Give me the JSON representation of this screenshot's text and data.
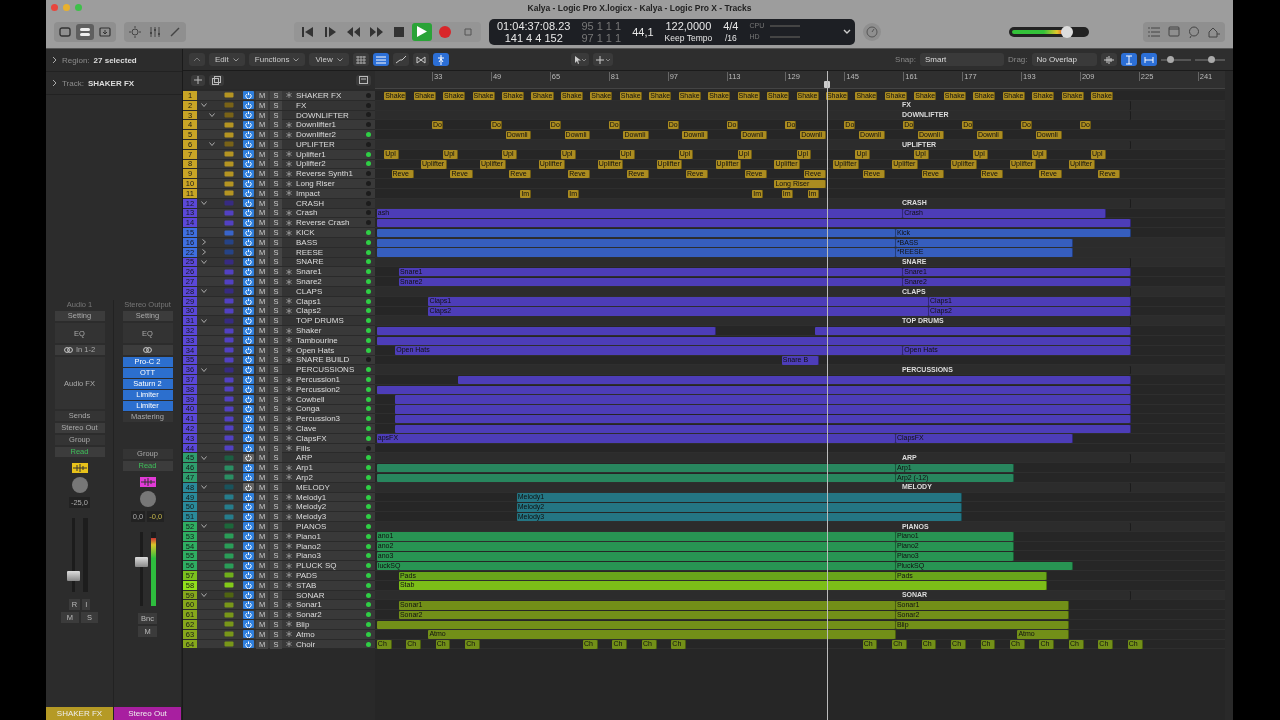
{
  "window": {
    "title": "Kalya - Logic Pro X.logicx - Kalya - Logic Pro X - Tracks"
  },
  "lcd": {
    "time": "01:04:37:08.23",
    "bars": "141 4 4 152",
    "locator_start": "95 1 1 1",
    "locator_end": "97 1 1 1",
    "sample_rate": "44,1",
    "tempo": "122,0000",
    "tempo_mode": "Keep Tempo",
    "signature": "4/4",
    "division": "/16",
    "cpu_label": "CPU",
    "hd_label": "HD"
  },
  "transport": {
    "playing": true,
    "recording": false
  },
  "master_volume": {
    "level": 0.72
  },
  "inspector": {
    "region_label": "Region:",
    "region_value": "27 selected",
    "track_label": "Track:",
    "track_value": "SHAKER FX"
  },
  "strips": [
    {
      "header": "Audio 1",
      "setting": "Setting",
      "eq": "EQ",
      "input": "In 1-2",
      "fx_label": "Audio FX",
      "sends": "Sends",
      "output": "Stereo Out",
      "group": "Group",
      "automation": "Read",
      "icon": {
        "color": "#e8c21a"
      },
      "pan": "-25,0",
      "fader": {
        "level": 0.22
      },
      "rec": [
        "R",
        "I"
      ],
      "buttons": [
        "M",
        "S"
      ],
      "name": "SHAKER FX",
      "color": "#b59a25"
    },
    {
      "header": "Stereo Output",
      "setting": "Setting",
      "eq": "EQ",
      "fx_label": "Mastering",
      "plugins": [
        "Pro-C 2",
        "OTT",
        "Saturn 2",
        "Limiter",
        "Limiter"
      ],
      "group": "Group",
      "automation": "Read",
      "icon": {
        "color": "#e23ad8"
      },
      "pan": "0,0",
      "peak": "-0,0",
      "fader": {
        "level": 0.6
      },
      "meter": {
        "level": 0.92
      },
      "rec": [
        "Bnc"
      ],
      "buttons": [
        "M"
      ],
      "name": "Stereo Out",
      "color": "#a81fa0"
    }
  ],
  "menus": [
    "Edit",
    "Functions",
    "View"
  ],
  "snap": {
    "label": "Snap:",
    "value": "Smart"
  },
  "drag": {
    "label": "Drag:",
    "value": "No Overlap"
  },
  "zoom_sliders": [
    {
      "level": 0.3
    },
    {
      "level": 0.55
    }
  ],
  "ruler": [
    "33",
    "49",
    "65",
    "81",
    "97",
    "113",
    "129",
    "145",
    "161",
    "177",
    "193",
    "209",
    "225",
    "241"
  ],
  "playhead": {
    "level": 0.532
  },
  "tracks": [
    {
      "num": "1",
      "name": "SHAKER FX",
      "kind": "audio",
      "mute": "M",
      "solo": "S",
      "on": true,
      "active": false,
      "color": "#c9a526",
      "regions": [
        {
          "kind": "region",
          "label": "Shake"
        },
        {
          "kind": "region",
          "label": "Shake"
        },
        {
          "kind": "region",
          "label": "Shake"
        },
        {
          "kind": "region",
          "label": "Shake"
        },
        {
          "kind": "region",
          "label": "Shake"
        },
        {
          "kind": "region",
          "label": "Shake"
        },
        {
          "kind": "region",
          "label": "Shake"
        },
        {
          "kind": "region",
          "label": "Shake"
        },
        {
          "kind": "region",
          "label": "Shake"
        },
        {
          "kind": "region",
          "label": "Shake"
        },
        {
          "kind": "region",
          "label": "Shake"
        },
        {
          "kind": "region",
          "label": "Shake"
        },
        {
          "kind": "region",
          "label": "Shake"
        },
        {
          "kind": "region",
          "label": "Shake"
        },
        {
          "kind": "region",
          "label": "Shake"
        },
        {
          "kind": "region",
          "label": "Shake"
        },
        {
          "kind": "region",
          "label": "Shake"
        },
        {
          "kind": "region",
          "label": "Shake"
        },
        {
          "kind": "region",
          "label": "Shake"
        },
        {
          "kind": "region",
          "label": "Shake"
        },
        {
          "kind": "region",
          "label": "Shake"
        },
        {
          "kind": "region",
          "label": "Shake"
        },
        {
          "kind": "region",
          "label": "Shake"
        },
        {
          "kind": "region",
          "label": "Shake"
        },
        {
          "kind": "region",
          "label": "Shake"
        }
      ]
    },
    {
      "num": "2",
      "name": "FX",
      "kind": "folder",
      "mute": "M",
      "solo": "S",
      "on": true,
      "active": false,
      "expanded": true,
      "color": "#c9a526",
      "regions": [
        {
          "kind": "region",
          "label": "FX"
        }
      ],
      "children": [
        {
          "num": "3",
          "name": "DOWNLIFTER",
          "kind": "folder",
          "mute": "M",
          "solo": "S",
          "on": true,
          "active": false,
          "expanded": true,
          "regions": [
            {
              "kind": "region",
              "label": "DOWNLIFTER"
            }
          ],
          "children": [
            {
              "num": "4",
              "name": "Downlifter1",
              "kind": "audio",
              "mute": "M",
              "solo": "S",
              "on": true,
              "active": false,
              "regions": [
                {
                  "kind": "region",
                  "label": "Do"
                },
                {
                  "kind": "region",
                  "label": "Do"
                },
                {
                  "kind": "region",
                  "label": "Do"
                },
                {
                  "kind": "region",
                  "label": "Do"
                },
                {
                  "kind": "region",
                  "label": "Do"
                },
                {
                  "kind": "region",
                  "label": "Do"
                },
                {
                  "kind": "region",
                  "label": "Do"
                },
                {
                  "kind": "region",
                  "label": "Do"
                },
                {
                  "kind": "region",
                  "label": "Do"
                },
                {
                  "kind": "region",
                  "label": "Do"
                },
                {
                  "kind": "region",
                  "label": "Do"
                },
                {
                  "kind": "region",
                  "label": "Do"
                }
              ]
            },
            {
              "num": "5",
              "name": "Downlifter2",
              "kind": "audio",
              "mute": "M",
              "solo": "S",
              "on": true,
              "active": true,
              "regions": [
                {
                  "kind": "region",
                  "label": "Downli"
                },
                {
                  "kind": "region",
                  "label": "Downli"
                },
                {
                  "kind": "region",
                  "label": "Downli"
                },
                {
                  "kind": "region",
                  "label": "Downli"
                },
                {
                  "kind": "region",
                  "label": "Downli"
                },
                {
                  "kind": "region",
                  "label": "Downli"
                },
                {
                  "kind": "region",
                  "label": "Downli"
                },
                {
                  "kind": "region",
                  "label": "Downli"
                },
                {
                  "kind": "region",
                  "label": "Downli"
                },
                {
                  "kind": "region",
                  "label": "Downli"
                }
              ]
            }
          ]
        },
        {
          "num": "6",
          "name": "UPLIFTER",
          "kind": "folder",
          "mute": "M",
          "solo": "S",
          "on": true,
          "active": false,
          "expanded": true,
          "regions": [
            {
              "kind": "region",
              "label": "UPLIFTER"
            }
          ],
          "children": [
            {
              "num": "7",
              "name": "Uplifter1",
              "kind": "audio",
              "mute": "M",
              "solo": "S",
              "on": true,
              "active": true,
              "regions": [
                {
                  "kind": "region",
                  "label": "Upl"
                },
                {
                  "kind": "region",
                  "label": "Upl"
                },
                {
                  "kind": "region",
                  "label": "Upl"
                },
                {
                  "kind": "region",
                  "label": "Upl"
                },
                {
                  "kind": "region",
                  "label": "Upl"
                },
                {
                  "kind": "region",
                  "label": "Upl"
                },
                {
                  "kind": "region",
                  "label": "Upl"
                },
                {
                  "kind": "region",
                  "label": "Upl"
                },
                {
                  "kind": "region",
                  "label": "Upl"
                },
                {
                  "kind": "region",
                  "label": "Upl"
                },
                {
                  "kind": "region",
                  "label": "Upl"
                },
                {
                  "kind": "region",
                  "label": "Upl"
                },
                {
                  "kind": "region",
                  "label": "Upl"
                }
              ]
            },
            {
              "num": "8",
              "name": "Uplifter2",
              "kind": "audio",
              "mute": "M",
              "solo": "S",
              "on": true,
              "active": true,
              "regions": [
                {
                  "kind": "region",
                  "label": "Uplifter"
                },
                {
                  "kind": "region",
                  "label": "Uplifter"
                },
                {
                  "kind": "region",
                  "label": "Uplifter"
                },
                {
                  "kind": "region",
                  "label": "Uplifter"
                },
                {
                  "kind": "region",
                  "label": "Uplifter"
                },
                {
                  "kind": "region",
                  "label": "Uplifter"
                },
                {
                  "kind": "region",
                  "label": "Uplifter"
                },
                {
                  "kind": "region",
                  "label": "Uplifter"
                },
                {
                  "kind": "region",
                  "label": "Uplifter"
                },
                {
                  "kind": "region",
                  "label": "Uplifter"
                },
                {
                  "kind": "region",
                  "label": "Uplifter"
                },
                {
                  "kind": "region",
                  "label": "Uplifter"
                }
              ]
            }
          ]
        },
        {
          "num": "9",
          "name": "Reverse Synth1",
          "kind": "audio",
          "mute": "M",
          "solo": "S",
          "on": true,
          "active": false,
          "regions": [
            {
              "kind": "region",
              "label": "Reve"
            },
            {
              "kind": "region",
              "label": "Reve"
            },
            {
              "kind": "region",
              "label": "Reve"
            },
            {
              "kind": "region",
              "label": "Reve"
            },
            {
              "kind": "region",
              "label": "Reve"
            },
            {
              "kind": "region",
              "label": "Reve"
            },
            {
              "kind": "region",
              "label": "Reve"
            },
            {
              "kind": "region",
              "label": "Reve"
            },
            {
              "kind": "region",
              "label": "Reve"
            },
            {
              "kind": "region",
              "label": "Reve"
            },
            {
              "kind": "region",
              "label": "Reve"
            },
            {
              "kind": "region",
              "label": "Reve"
            },
            {
              "kind": "region",
              "label": "Reve"
            }
          ]
        },
        {
          "num": "10",
          "name": "Long Riser",
          "kind": "audio",
          "mute": "M",
          "solo": "S",
          "on": true,
          "active": false,
          "regions": [
            {
              "kind": "region",
              "label": "Long Riser"
            }
          ]
        },
        {
          "num": "11",
          "name": "Impact",
          "kind": "audio",
          "mute": "M",
          "solo": "S",
          "on": true,
          "active": false,
          "regions": [
            {
              "kind": "region",
              "label": "Im"
            },
            {
              "kind": "region",
              "label": "Im"
            },
            {
              "kind": "region",
              "label": "Im"
            },
            {
              "kind": "region",
              "label": "Im"
            },
            {
              "kind": "region",
              "label": "Im"
            }
          ]
        }
      ]
    },
    {
      "num": "12",
      "name": "CRASH",
      "kind": "folder",
      "mute": "M",
      "solo": "S",
      "on": true,
      "active": false,
      "expanded": true,
      "color": "#5b48d8",
      "regions": [
        {
          "kind": "region",
          "label": "CRASH"
        }
      ],
      "children": [
        {
          "num": "13",
          "name": "Crash",
          "kind": "audio",
          "mute": "M",
          "solo": "S",
          "on": true,
          "active": false,
          "regions": [
            {
              "kind": "region",
              "label": "ash"
            },
            {
              "kind": "region",
              "label": "Crash"
            }
          ]
        },
        {
          "num": "14",
          "name": "Reverse Crash",
          "kind": "audio",
          "mute": "M",
          "solo": "S",
          "on": true,
          "active": false,
          "regions": [
            {
              "kind": "region"
            }
          ]
        },
        {
          "num": "15",
          "name": "KICK",
          "kind": "audio",
          "mute": "M",
          "solo": "S",
          "on": true,
          "active": true,
          "color": "#3f6fe0",
          "regions": [
            {
              "kind": "region"
            },
            {
              "kind": "region",
              "label": "Kick"
            }
          ]
        }
      ]
    },
    {
      "num": "16",
      "name": "BASS",
      "kind": "folder",
      "mute": "M",
      "solo": "S",
      "on": true,
      "active": true,
      "expanded": false,
      "color": "#3f6fe0",
      "regions": [
        {
          "kind": "region"
        },
        {
          "kind": "region",
          "label": "*BASS"
        }
      ]
    },
    {
      "num": "22",
      "name": "REESE",
      "kind": "folder",
      "mute": "M",
      "solo": "S",
      "on": true,
      "active": true,
      "expanded": false,
      "color": "#3f6fe0",
      "regions": [
        {
          "kind": "region"
        },
        {
          "kind": "region",
          "label": "*REESE"
        }
      ]
    },
    {
      "num": "25",
      "name": "SNARE",
      "kind": "folder",
      "mute": "M",
      "solo": "S",
      "on": true,
      "active": true,
      "expanded": true,
      "color": "#5b48d8",
      "regions": [
        {
          "kind": "region",
          "label": "SNARE"
        }
      ],
      "children": [
        {
          "num": "26",
          "name": "Snare1",
          "kind": "audio",
          "mute": "M",
          "solo": "S",
          "on": true,
          "active": true,
          "regions": [
            {
              "kind": "region",
              "label": "Snare1"
            },
            {
              "kind": "region",
              "label": "Snare1"
            }
          ]
        },
        {
          "num": "27",
          "name": "Snare2",
          "kind": "audio",
          "mute": "M",
          "solo": "S",
          "on": true,
          "active": true,
          "regions": [
            {
              "kind": "region",
              "label": "Snare2"
            },
            {
              "kind": "region",
              "label": "Snare2"
            }
          ]
        }
      ]
    },
    {
      "num": "28",
      "name": "CLAPS",
      "kind": "folder",
      "mute": "M",
      "solo": "S",
      "on": true,
      "active": true,
      "expanded": true,
      "color": "#5b48d8",
      "regions": [
        {
          "kind": "region",
          "label": "CLAPS"
        }
      ],
      "children": [
        {
          "num": "29",
          "name": "Claps1",
          "kind": "audio",
          "mute": "M",
          "solo": "S",
          "on": true,
          "active": true,
          "regions": [
            {
              "kind": "region",
              "label": "Claps1"
            },
            {
              "kind": "region",
              "label": "Claps1"
            }
          ]
        },
        {
          "num": "30",
          "name": "Claps2",
          "kind": "audio",
          "mute": "M",
          "solo": "S",
          "on": true,
          "active": true,
          "regions": [
            {
              "kind": "region",
              "label": "Claps2"
            },
            {
              "kind": "region",
              "label": "Claps2"
            }
          ]
        }
      ]
    },
    {
      "num": "31",
      "name": "TOP DRUMS",
      "kind": "folder",
      "mute": "M",
      "solo": "S",
      "on": true,
      "active": true,
      "expanded": true,
      "color": "#5b48d8",
      "regions": [
        {
          "kind": "region",
          "label": "TOP DRUMS"
        }
      ],
      "children": [
        {
          "num": "32",
          "name": "Shaker",
          "kind": "audio",
          "mute": "M",
          "solo": "S",
          "on": true,
          "active": true,
          "regions": [
            {
              "kind": "region"
            },
            {
              "kind": "region"
            }
          ]
        },
        {
          "num": "33",
          "name": "Tambourine",
          "kind": "audio",
          "mute": "M",
          "solo": "S",
          "on": true,
          "active": true,
          "regions": [
            {
              "kind": "region"
            }
          ]
        },
        {
          "num": "34",
          "name": "Open Hats",
          "kind": "audio",
          "mute": "M",
          "solo": "S",
          "on": true,
          "active": true,
          "regions": [
            {
              "kind": "region",
              "label": "Open Hats"
            },
            {
              "kind": "region",
              "label": "Open Hats"
            }
          ]
        },
        {
          "num": "35",
          "name": "SNARE BUILD",
          "kind": "audio",
          "mute": "M",
          "solo": "S",
          "on": true,
          "active": false,
          "regions": [
            {
              "kind": "region",
              "label": "Snare B"
            }
          ]
        }
      ]
    },
    {
      "num": "36",
      "name": "PERCUSSIONS",
      "kind": "folder",
      "mute": "M",
      "solo": "S",
      "on": true,
      "active": true,
      "expanded": true,
      "color": "#5b48d8",
      "regions": [
        {
          "kind": "region",
          "label": "PERCUSSIONS"
        }
      ],
      "children": [
        {
          "num": "37",
          "name": "Percussion1",
          "kind": "audio",
          "mute": "M",
          "solo": "S",
          "on": true,
          "active": true,
          "regions": [
            {
              "kind": "region"
            }
          ]
        },
        {
          "num": "38",
          "name": "Percussion2",
          "kind": "audio",
          "mute": "M",
          "solo": "S",
          "on": true,
          "active": true,
          "regions": [
            {
              "kind": "region"
            }
          ]
        },
        {
          "num": "39",
          "name": "Cowbell",
          "kind": "audio",
          "mute": "M",
          "solo": "S",
          "on": true,
          "active": true,
          "regions": [
            {
              "kind": "region"
            }
          ]
        },
        {
          "num": "40",
          "name": "Conga",
          "kind": "audio",
          "mute": "M",
          "solo": "S",
          "on": true,
          "active": true,
          "regions": [
            {
              "kind": "region"
            }
          ]
        },
        {
          "num": "41",
          "name": "Percussion3",
          "kind": "audio",
          "mute": "M",
          "solo": "S",
          "on": true,
          "active": true,
          "regions": [
            {
              "kind": "region"
            }
          ]
        },
        {
          "num": "42",
          "name": "Clave",
          "kind": "audio",
          "mute": "M",
          "solo": "S",
          "on": true,
          "active": true,
          "regions": [
            {
              "kind": "region"
            }
          ]
        },
        {
          "num": "43",
          "name": "ClapsFX",
          "kind": "audio",
          "mute": "M",
          "solo": "S",
          "on": true,
          "active": true,
          "regions": [
            {
              "kind": "region",
              "label": "apsFX"
            },
            {
              "kind": "region",
              "label": "ClapsFX"
            }
          ]
        },
        {
          "num": "44",
          "name": "Fills",
          "kind": "audio",
          "mute": "M",
          "solo": "S",
          "on": true,
          "active": false
        }
      ]
    },
    {
      "num": "45",
      "name": "ARP",
      "kind": "folder",
      "mute": "M",
      "solo": "S",
      "on": false,
      "active": true,
      "expanded": true,
      "color": "#2f9e6e",
      "regions": [
        {
          "kind": "region",
          "label": "ARP"
        }
      ],
      "children": [
        {
          "num": "46",
          "name": "Arp1",
          "kind": "audio",
          "mute": "M",
          "solo": "S",
          "on": true,
          "active": true,
          "regions": [
            {
              "kind": "region"
            },
            {
              "kind": "region",
              "label": "Arp1"
            }
          ]
        },
        {
          "num": "47",
          "name": "Arp2",
          "kind": "audio",
          "mute": "M",
          "solo": "S",
          "on": true,
          "active": true,
          "regions": [
            {
              "kind": "region"
            },
            {
              "kind": "region",
              "label": "Arp2 (-12)"
            }
          ]
        }
      ]
    },
    {
      "num": "48",
      "name": "MELODY",
      "kind": "folder",
      "mute": "M",
      "solo": "S",
      "on": false,
      "active": true,
      "expanded": true,
      "color": "#2a8a9a",
      "regions": [
        {
          "kind": "region",
          "label": "MELODY"
        }
      ],
      "children": [
        {
          "num": "49",
          "name": "Melody1",
          "kind": "audio",
          "mute": "M",
          "solo": "S",
          "on": true,
          "active": true,
          "regions": [
            {
              "kind": "region",
              "label": "Melody1"
            }
          ]
        },
        {
          "num": "50",
          "name": "Melody2",
          "kind": "audio",
          "mute": "M",
          "solo": "S",
          "on": true,
          "active": true,
          "regions": [
            {
              "kind": "region",
              "label": "Melody2"
            }
          ]
        },
        {
          "num": "51",
          "name": "Melody3",
          "kind": "audio",
          "mute": "M",
          "solo": "S",
          "on": true,
          "active": true,
          "regions": [
            {
              "kind": "region",
              "label": "Melody3"
            }
          ]
        }
      ]
    },
    {
      "num": "52",
      "name": "PIANOS",
      "kind": "folder",
      "mute": "M",
      "solo": "S",
      "on": true,
      "active": true,
      "expanded": true,
      "color": "#2fae62",
      "regions": [
        {
          "kind": "region",
          "label": "PIANOS"
        }
      ],
      "children": [
        {
          "num": "53",
          "name": "Piano1",
          "kind": "audio",
          "mute": "M",
          "solo": "S",
          "on": true,
          "active": true,
          "regions": [
            {
              "kind": "region",
              "label": "ano1"
            },
            {
              "kind": "region",
              "label": "Piano1"
            }
          ]
        },
        {
          "num": "54",
          "name": "Piano2",
          "kind": "audio",
          "mute": "M",
          "solo": "S",
          "on": true,
          "active": true,
          "regions": [
            {
              "kind": "region",
              "label": "ano2"
            },
            {
              "kind": "region",
              "label": "Piano2"
            }
          ]
        },
        {
          "num": "55",
          "name": "Piano3",
          "kind": "audio",
          "mute": "M",
          "solo": "S",
          "on": true,
          "active": true,
          "regions": [
            {
              "kind": "region",
              "label": "ano3"
            },
            {
              "kind": "region",
              "label": "Piano3"
            }
          ]
        },
        {
          "num": "56",
          "name": "PLUCK SQ",
          "kind": "audio",
          "mute": "M",
          "solo": "S",
          "on": true,
          "active": true,
          "regions": [
            {
              "kind": "region",
              "label": "luckSQ"
            },
            {
              "kind": "region",
              "label": "PluckSQ"
            }
          ]
        },
        {
          "num": "57",
          "name": "PADS",
          "kind": "audio",
          "mute": "M",
          "solo": "S",
          "on": true,
          "active": true,
          "color": "#7cc21e",
          "regions": [
            {
              "kind": "region",
              "label": "Pads"
            },
            {
              "kind": "region",
              "label": "Pads"
            }
          ]
        },
        {
          "num": "58",
          "name": "STAB",
          "kind": "audio",
          "mute": "M",
          "solo": "S",
          "on": true,
          "active": true,
          "color": "#92e01c",
          "regions": [
            {
              "kind": "region",
              "label": "Stab"
            }
          ]
        }
      ]
    },
    {
      "num": "59",
      "name": "SONAR",
      "kind": "folder",
      "mute": "M",
      "solo": "S",
      "on": true,
      "active": true,
      "expanded": true,
      "color": "#86a81c",
      "regions": [
        {
          "kind": "region",
          "label": "SONAR"
        }
      ],
      "children": [
        {
          "num": "60",
          "name": "Sonar1",
          "kind": "audio",
          "mute": "M",
          "solo": "S",
          "on": true,
          "active": true,
          "regions": [
            {
              "kind": "region",
              "label": "Sonar1"
            },
            {
              "kind": "region",
              "label": "Sonar1"
            }
          ]
        },
        {
          "num": "61",
          "name": "Sonar2",
          "kind": "audio",
          "mute": "M",
          "solo": "S",
          "on": true,
          "active": true,
          "regions": [
            {
              "kind": "region",
              "label": "Sonar2"
            },
            {
              "kind": "region",
              "label": "Sonar2"
            }
          ]
        },
        {
          "num": "62",
          "name": "Blip",
          "kind": "audio",
          "mute": "M",
          "solo": "S",
          "on": true,
          "active": true,
          "regions": [
            {
              "kind": "region"
            },
            {
              "kind": "region",
              "label": "Blip"
            }
          ]
        },
        {
          "num": "63",
          "name": "Atmo",
          "kind": "audio",
          "mute": "M",
          "solo": "S",
          "on": true,
          "active": true,
          "regions": [
            {
              "kind": "region",
              "label": "Atmo"
            },
            {
              "kind": "region",
              "label": "Atmo"
            }
          ]
        },
        {
          "num": "64",
          "name": "Choir",
          "kind": "audio",
          "mute": "M",
          "solo": "S",
          "on": true,
          "active": true,
          "regions": [
            {
              "kind": "region",
              "label": "Ch"
            },
            {
              "kind": "region",
              "label": "Ch"
            },
            {
              "kind": "region",
              "label": "Ch"
            },
            {
              "kind": "region",
              "label": "Ch"
            },
            {
              "kind": "region",
              "label": "Ch"
            },
            {
              "kind": "region",
              "label": "Ch"
            },
            {
              "kind": "region",
              "label": "Ch"
            },
            {
              "kind": "region",
              "label": "Ch"
            },
            {
              "kind": "region",
              "label": "Ch"
            },
            {
              "kind": "region",
              "label": "Ch"
            },
            {
              "kind": "region",
              "label": "Ch"
            },
            {
              "kind": "region",
              "label": "Ch"
            },
            {
              "kind": "region",
              "label": "Ch"
            },
            {
              "kind": "region",
              "label": "Ch"
            },
            {
              "kind": "region",
              "label": "Ch"
            },
            {
              "kind": "region",
              "label": "Ch"
            },
            {
              "kind": "region",
              "label": "Ch"
            },
            {
              "kind": "region",
              "label": "Ch"
            }
          ]
        }
      ]
    }
  ]
}
